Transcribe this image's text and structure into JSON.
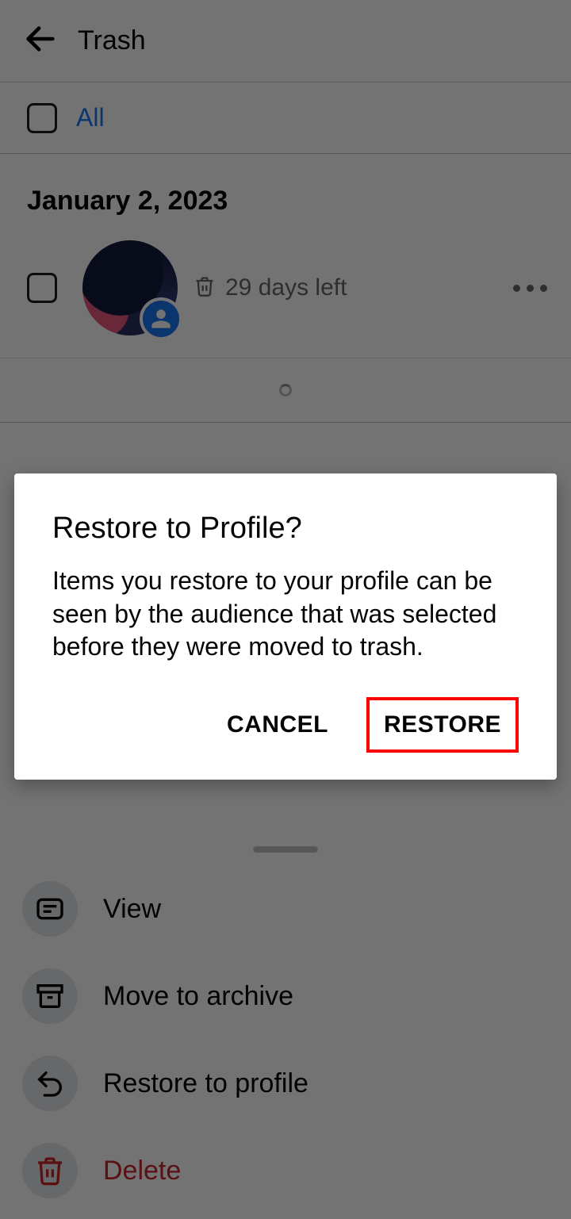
{
  "header": {
    "title": "Trash"
  },
  "filter": {
    "all_label": "All"
  },
  "groups": [
    {
      "date": "January 2, 2023",
      "items": [
        {
          "days_left": "29 days left"
        }
      ]
    }
  ],
  "sheet": {
    "options": [
      {
        "label": "View"
      },
      {
        "label": "Move to archive"
      },
      {
        "label": "Restore to profile"
      },
      {
        "label": "Delete"
      }
    ]
  },
  "dialog": {
    "title": "Restore to Profile?",
    "body": "Items you restore to your profile can be seen by the audience that was selected before they were moved to trash.",
    "cancel": "CANCEL",
    "confirm": "RESTORE"
  }
}
